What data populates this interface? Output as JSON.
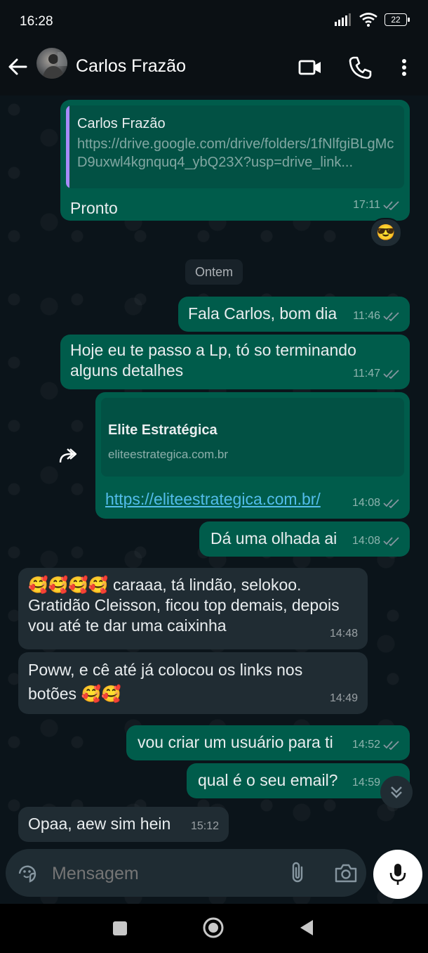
{
  "status_bar": {
    "time": "16:28",
    "battery": "22"
  },
  "header": {
    "contact_name": "Carlos Frazão"
  },
  "messages": {
    "m1": {
      "quoted_name": "Carlos Frazão",
      "quoted_text": "https://drive.google.com/drive/folders/1fNlfgiBLgMcD9uxwl4kgnquq4_ybQ23X?usp=drive_link...",
      "text": "Pronto",
      "time": "17:11",
      "reaction": "😎"
    },
    "date_separator": "Ontem",
    "m2": {
      "text": "Fala Carlos, bom dia",
      "time": "11:46"
    },
    "m3": {
      "text": "Hoje eu te passo a Lp, tó so terminando alguns detalhes",
      "time": "11:47"
    },
    "m4": {
      "link_title": "Elite Estratégica",
      "link_domain": "eliteestrategica.com.br",
      "link_url": "https://eliteestrategica.com.br/",
      "time": "14:08"
    },
    "m5": {
      "text": "Dá uma olhada ai",
      "time": "14:08"
    },
    "m6": {
      "text": "🥰🥰🥰🥰 caraaa, tá lindão, selokoo. Gratidão Cleisson, ficou top demais, depois vou até te dar uma caixinha",
      "time": "14:48"
    },
    "m7": {
      "text": "Poww, e cê até já colocou os links nos botões 🥰🥰",
      "time": "14:49"
    },
    "m8": {
      "text": "vou criar um usuário para ti",
      "time": "14:52"
    },
    "m9": {
      "text": "qual é o seu email?",
      "time": "14:59"
    },
    "m10": {
      "text": "Opaa, aew sim hein",
      "time": "15:12"
    }
  },
  "composer": {
    "placeholder": "Mensagem"
  },
  "icons": {
    "back": "arrow-left-icon",
    "video": "video-call-icon",
    "phone": "phone-icon",
    "menu": "more-vert-icon",
    "emoji": "emoji-sticker-icon",
    "attach": "paperclip-icon",
    "camera": "camera-icon",
    "mic": "mic-icon"
  },
  "colors": {
    "outgoing_bubble": "#005c4b",
    "incoming_bubble": "#202c33",
    "link": "#53bdeb",
    "read_ticks": "#8696a0"
  }
}
